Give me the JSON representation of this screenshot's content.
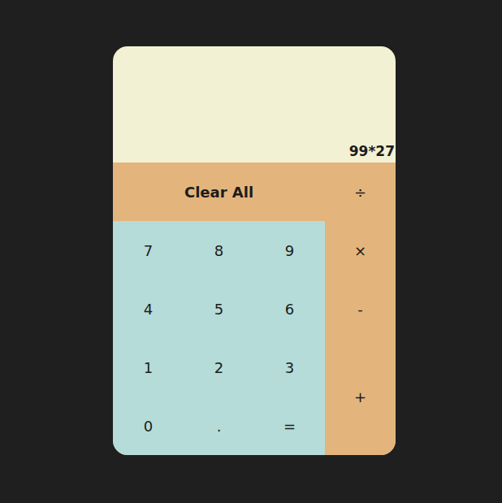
{
  "display": "99*27",
  "keys": [
    {
      "label": "Clear All",
      "kind": "clear"
    },
    {
      "label": "÷",
      "kind": "operator"
    },
    {
      "label": "7",
      "kind": "digit"
    },
    {
      "label": "8",
      "kind": "digit"
    },
    {
      "label": "9",
      "kind": "digit"
    },
    {
      "label": "×",
      "kind": "operator"
    },
    {
      "label": "4",
      "kind": "digit"
    },
    {
      "label": "5",
      "kind": "digit"
    },
    {
      "label": "6",
      "kind": "digit"
    },
    {
      "label": "-",
      "kind": "operator"
    },
    {
      "label": "1",
      "kind": "digit"
    },
    {
      "label": "2",
      "kind": "digit"
    },
    {
      "label": "3",
      "kind": "digit"
    },
    {
      "label": "+",
      "kind": "operator"
    },
    {
      "label": "0",
      "kind": "digit"
    },
    {
      "label": ".",
      "kind": "digit"
    },
    {
      "label": "=",
      "kind": "equals"
    }
  ]
}
